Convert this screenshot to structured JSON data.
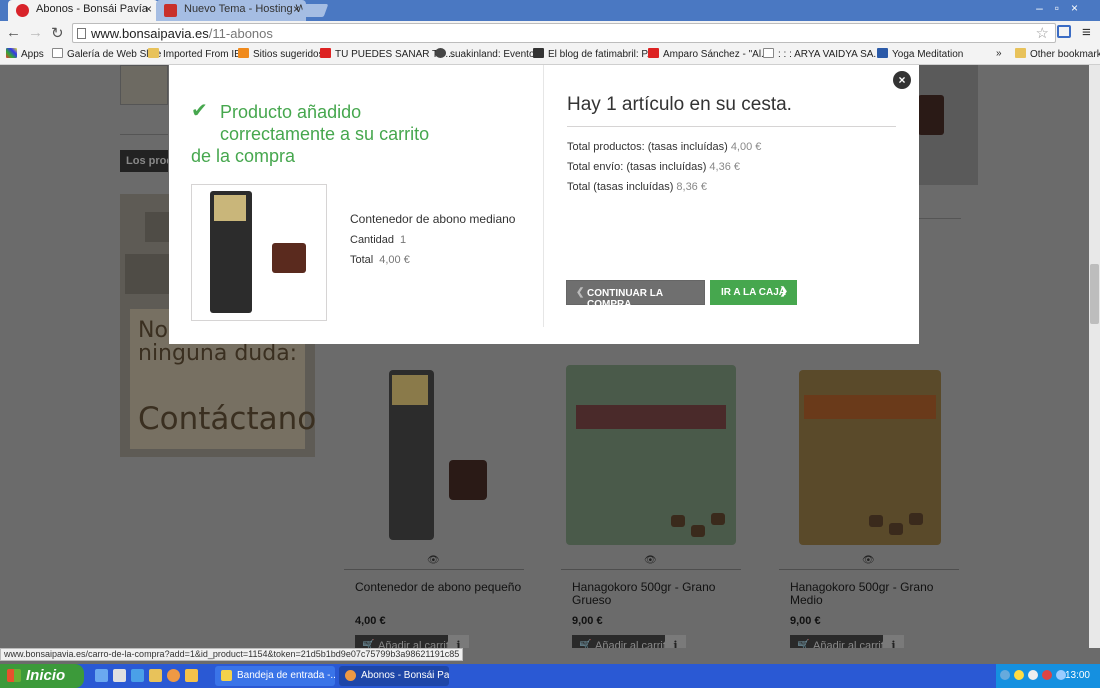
{
  "browser": {
    "tabs": [
      {
        "title": "Abonos - Bonsái Pavía"
      },
      {
        "title": "Nuevo Tema - Hosting Word"
      }
    ],
    "url_domain": "www.bonsaipavia.es",
    "url_path": "/11-abonos",
    "bookmarks": [
      "Apps",
      "Galería de Web Slice",
      "Imported From IE",
      "Sitios sugeridos",
      "TU PUEDES SANAR TU...",
      "suakinland: Eventos",
      "El blog de fatimabril: P...",
      "Amparo Sánchez - \"Al...",
      ": : : ARYA VAIDYA SA...",
      "Yoga Meditation",
      "»",
      "Other bookmarks"
    ],
    "status_url": "www.bonsaipavia.es/carro-de-la-compra?add=1&id_product=1154&token=21d5b1bd9e07c75799b3a98621191c85"
  },
  "page": {
    "side_tag": "Los prod",
    "banner_line1": "No dudes con ninguna duda:",
    "banner_line2": "Contáctanos",
    "products": [
      {
        "name": "Contenedor de abono pequeño",
        "price": "4,00 €",
        "add_label": "Añadir al carrito",
        "info_label": "i"
      },
      {
        "name": "Hanagokoro 500gr - Grano Grueso",
        "price": "9,00 €",
        "add_label": "Añadir al carrito",
        "info_label": "i"
      },
      {
        "name": "Hanagokoro 500gr - Grano Medio",
        "price": "9,00 €",
        "add_label": "Añadir al carrito",
        "info_label": "i"
      }
    ]
  },
  "modal": {
    "success_line1": "Producto añadido correctamente a su carrito",
    "success_line2": "de la compra",
    "product_name": "Contenedor de abono mediano",
    "quantity_label": "Cantidad",
    "quantity_value": "1",
    "total_label": "Total",
    "total_value": "4,00 €",
    "cart_title": "Hay 1 artículo en su cesta.",
    "totals": [
      {
        "label": "Total productos: (tasas incluídas)",
        "value": "4,00 €"
      },
      {
        "label": "Total envío: (tasas incluídas)",
        "value": "4,36 €"
      },
      {
        "label": "Total (tasas incluídas)",
        "value": "8,36 €"
      }
    ],
    "continue_label": "CONTINUAR LA COMPRA",
    "checkout_label": "IR A LA CAJA",
    "accent_color": "#46a74e"
  },
  "taskbar": {
    "start_label": "Inicio",
    "items": [
      {
        "label": "Bandeja de entrada -..."
      },
      {
        "label": "Abonos - Bonsái Paví..."
      }
    ],
    "clock": "13:00"
  }
}
